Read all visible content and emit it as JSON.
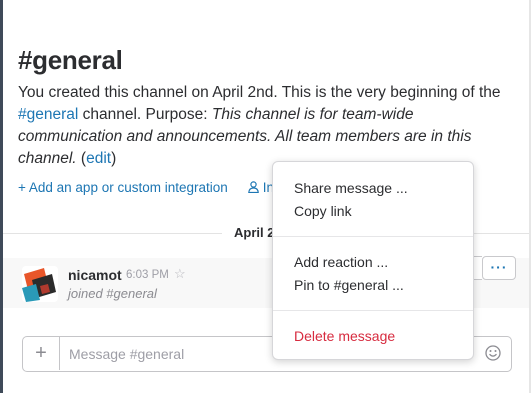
{
  "channel": {
    "title": "#general",
    "desc_prefix": "You created this channel on April 2nd. This is the very beginning of the ",
    "desc_channel_link": "#general",
    "desc_mid": " channel. Purpose: ",
    "desc_purpose": "This channel is for team-wide communication and announcements. All team members are in this channel.",
    "desc_open": " (",
    "desc_edit": "edit",
    "desc_close": ")"
  },
  "actions": {
    "add_integration": "+ Add an app or custom integration",
    "invite_partial": "In"
  },
  "divider": {
    "date": "April 2"
  },
  "message": {
    "author": "nicamot",
    "time": "6:03 PM",
    "star_glyph": "☆",
    "text": "joined #general",
    "more_label": "···"
  },
  "composer": {
    "plus": "+",
    "placeholder": "Message #general"
  },
  "context_menu": {
    "share": "Share message ...",
    "copy_link": "Copy link",
    "add_reaction": "Add reaction ...",
    "pin": "Pin to #general ...",
    "delete": "Delete message",
    "danger_color": "#d72b3f"
  },
  "colors": {
    "link": "#1d76b3",
    "sidebar_edge": "#3f4a59"
  }
}
